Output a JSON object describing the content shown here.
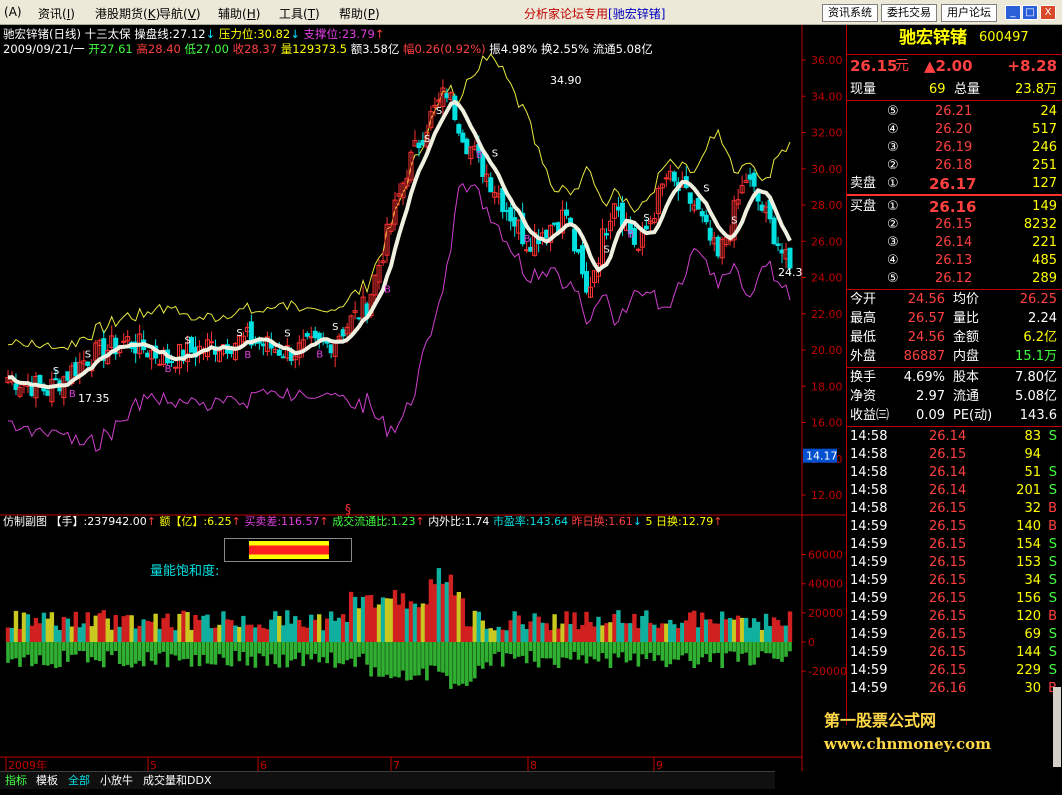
{
  "menu": {
    "items": [
      "资讯",
      "港股期货",
      "导航",
      "辅助",
      "工具",
      "帮助"
    ],
    "keys": [
      "I",
      "K",
      "V",
      "H",
      "T",
      "P"
    ],
    "alpha": "A"
  },
  "promo": {
    "text": "分析家论坛专用",
    "tag": "[驰宏锌锗]"
  },
  "sys_buttons": [
    "资讯系统",
    "委托交易",
    "用户论坛"
  ],
  "window_buttons": [
    "_",
    "□",
    "X"
  ],
  "header": {
    "name": "驰宏锌锗(日线)",
    "indicator": "十三太保",
    "line1_label": "操盘线:27.12",
    "arrow_down": "↓",
    "resist": "压力位:30.82",
    "support": "支撑位:23.79",
    "arrow_up": "↑"
  },
  "ohlc": {
    "date": "2009/09/21/一",
    "open": "开27.61",
    "high": "高28.40",
    "low": "低27.00",
    "close": "收28.37",
    "vol": "量129373.5",
    "amt": "额3.58亿",
    "chg": "幅0.26(0.92%)",
    "amp": "振4.98%",
    "turn": "换2.55%",
    "float": "流通5.08亿"
  },
  "price_axis": [
    "36.00",
    "34.00",
    "32.00",
    "30.00",
    "28.00",
    "26.00",
    "24.00",
    "22.00",
    "20.00",
    "18.00",
    "16.00",
    "14.00",
    "12.00"
  ],
  "annotations": {
    "high": "34.90",
    "low": "17.35",
    "last": "24.3",
    "cursor": "14.17",
    "s": "S",
    "b": "B"
  },
  "sub_header": {
    "title": "仿制副图",
    "hand": "【手】:237942.00",
    "hand_arrow": "↑",
    "amt": "额【亿】:6.25",
    "amt_arrow": "↑",
    "buysell": "买卖差:116.57",
    "buysell_arrow": "↑",
    "flow": "成交流通比:1.23",
    "flow_arrow": "↑",
    "inout": "内外比:1.74",
    "pe": "市盈率:143.64",
    "yturn": "昨日换:1.61",
    "yturn_arrow": "↓",
    "fiveday": "5 日换:12.79",
    "fiveday_arrow": "↑"
  },
  "sub_label": "量能饱和度:",
  "vol_axis": [
    "60000",
    "40000",
    "20000",
    "0",
    "-20000"
  ],
  "x_axis": [
    "2009年",
    "5",
    "6",
    "7",
    "8",
    "9"
  ],
  "marker": "§",
  "tabs": [
    "指标",
    "模板",
    "全部",
    "小放牛",
    "成交量和DDX"
  ],
  "quote": {
    "name": "驰宏锌锗",
    "code": "600497",
    "price": "26.15",
    "unit": "元",
    "change": "▲2.00",
    "pct": "+8.28",
    "now_vol_label": "现量",
    "now_vol": "69",
    "total_label": "总量",
    "total": "23.8万",
    "asks": [
      {
        "n": "⑤",
        "p": "26.21",
        "v": "24"
      },
      {
        "n": "④",
        "p": "26.20",
        "v": "517"
      },
      {
        "n": "③",
        "p": "26.19",
        "v": "246"
      },
      {
        "n": "②",
        "p": "26.18",
        "v": "251"
      }
    ],
    "ask1": {
      "label": "卖盘",
      "n": "①",
      "p": "26.17",
      "v": "127"
    },
    "bid1": {
      "label": "买盘",
      "n": "①",
      "p": "26.16",
      "v": "149"
    },
    "bids": [
      {
        "n": "②",
        "p": "26.15",
        "v": "8232"
      },
      {
        "n": "③",
        "p": "26.14",
        "v": "221"
      },
      {
        "n": "④",
        "p": "26.13",
        "v": "485"
      },
      {
        "n": "⑤",
        "p": "26.12",
        "v": "289"
      }
    ],
    "stats": [
      {
        "l1": "今开",
        "v1": "24.56",
        "l2": "均价",
        "v2": "26.25"
      },
      {
        "l1": "最高",
        "v1": "26.57",
        "l2": "量比",
        "v2": "2.24"
      },
      {
        "l1": "最低",
        "v1": "24.56",
        "l2": "金额",
        "v2": "6.2亿"
      },
      {
        "l1": "外盘",
        "v1": "86887",
        "l2": "内盘",
        "v2": "15.1万"
      },
      {
        "l1": "换手",
        "v1": "4.69%",
        "l2": "股本",
        "v2": "7.80亿"
      },
      {
        "l1": "净资",
        "v1": "2.97",
        "l2": "流通",
        "v2": "5.08亿"
      },
      {
        "l1": "收益㈢",
        "v1": "0.09",
        "l2": "PE(动)",
        "v2": "143.6"
      }
    ],
    "ticks": [
      {
        "t": "14:58",
        "p": "26.14",
        "v": "83",
        "s": "S"
      },
      {
        "t": "14:58",
        "p": "26.15",
        "v": "94",
        "s": ""
      },
      {
        "t": "14:58",
        "p": "26.14",
        "v": "51",
        "s": "S"
      },
      {
        "t": "14:58",
        "p": "26.14",
        "v": "201",
        "s": "S"
      },
      {
        "t": "14:58",
        "p": "26.15",
        "v": "32",
        "s": "B"
      },
      {
        "t": "14:59",
        "p": "26.15",
        "v": "140",
        "s": "B"
      },
      {
        "t": "14:59",
        "p": "26.15",
        "v": "154",
        "s": "S"
      },
      {
        "t": "14:59",
        "p": "26.15",
        "v": "153",
        "s": "S"
      },
      {
        "t": "14:59",
        "p": "26.15",
        "v": "34",
        "s": "S"
      },
      {
        "t": "14:59",
        "p": "26.15",
        "v": "156",
        "s": "S"
      },
      {
        "t": "14:59",
        "p": "26.15",
        "v": "120",
        "s": "B"
      },
      {
        "t": "14:59",
        "p": "26.15",
        "v": "69",
        "s": "S"
      },
      {
        "t": "14:59",
        "p": "26.15",
        "v": "144",
        "s": "S"
      },
      {
        "t": "14:59",
        "p": "26.15",
        "v": "229",
        "s": "S"
      },
      {
        "t": "14:59",
        "p": "26.16",
        "v": "30",
        "s": "B"
      }
    ]
  },
  "watermark": {
    "line1": "第一股票公式网",
    "line2": "www.chnmoney.com"
  },
  "colors": {
    "up": "#ff3232",
    "down": "#00e0e0",
    "ma": "#f0f0e0",
    "upper": "#e8e840",
    "lower": "#d040d0",
    "yellow": "#ffff00",
    "vol_red": "#d02020",
    "vol_cyan": "#10b0a0",
    "vol_yellow": "#c8c820",
    "vol_green": "#30b030"
  }
}
